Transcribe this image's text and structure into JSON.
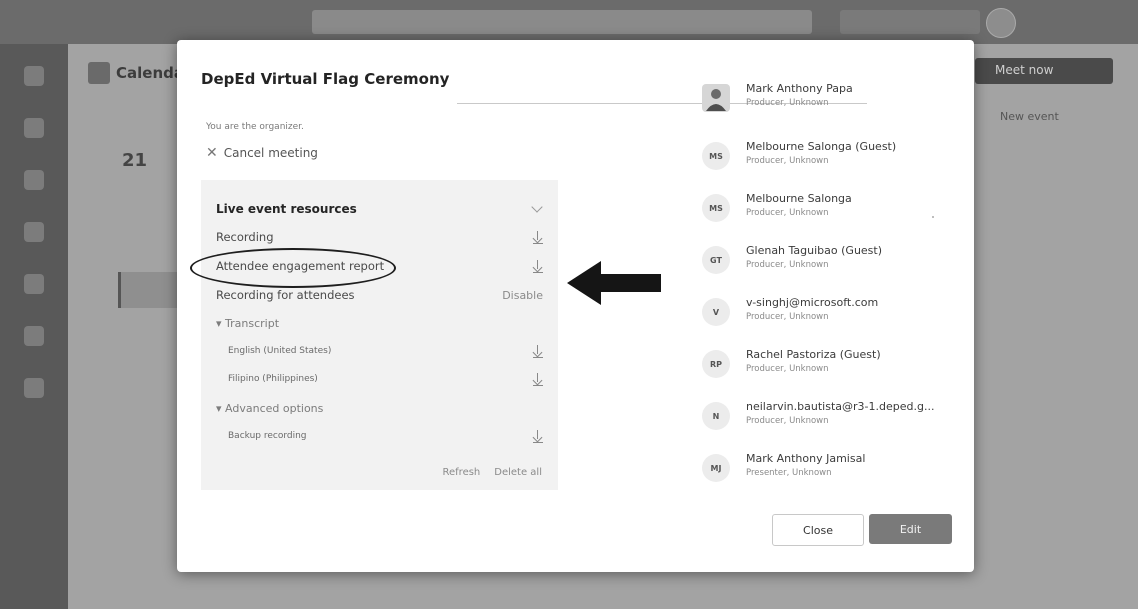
{
  "background": {
    "calendar_title": "Calendar",
    "date": "21",
    "meet_button": "Meet now",
    "right_hint": "New event"
  },
  "dialog": {
    "title": "DepEd Virtual Flag Ceremony",
    "organizer_note": "You are the organizer.",
    "cancel_label": "Cancel meeting",
    "resources": {
      "header": "Live event resources",
      "recording": "Recording",
      "engagement_report": "Attendee engagement report",
      "recording_attendees": "Recording for attendees",
      "recording_attendees_action": "Disable",
      "transcript": "Transcript",
      "transcript_items": [
        "English (United States)",
        "Filipino (Philippines)"
      ],
      "advanced": "Advanced options",
      "backup": "Backup recording",
      "refresh": "Refresh",
      "delete_all": "Delete all"
    },
    "participants": [
      {
        "initials": "",
        "name": "Mark Anthony Papa",
        "role": "Producer, Unknown"
      },
      {
        "initials": "MS",
        "name": "Melbourne Salonga (Guest)",
        "role": "Producer, Unknown"
      },
      {
        "initials": "MS",
        "name": "Melbourne Salonga",
        "role": "Producer, Unknown"
      },
      {
        "initials": "GT",
        "name": "Glenah Taguibao (Guest)",
        "role": "Producer, Unknown"
      },
      {
        "initials": "V",
        "name": "v-singhj@microsoft.com",
        "role": "Producer, Unknown"
      },
      {
        "initials": "RP",
        "name": "Rachel Pastoriza (Guest)",
        "role": "Producer, Unknown"
      },
      {
        "initials": "N",
        "name": "neilarvin.bautista@r3-1.deped.g...",
        "role": "Producer, Unknown"
      },
      {
        "initials": "MJ",
        "name": "Mark Anthony Jamisal",
        "role": "Presenter, Unknown"
      }
    ],
    "close_label": "Close",
    "edit_label": "Edit"
  },
  "colors": {
    "dim_background": "#9a9a9a",
    "dialog_bg": "#ffffff",
    "panel_bg": "#f2f2f2",
    "edit_button": "#7a7a7a"
  },
  "icons": [
    "close-icon",
    "download-icon",
    "chevron-down-icon",
    "arrow-left-icon"
  ]
}
